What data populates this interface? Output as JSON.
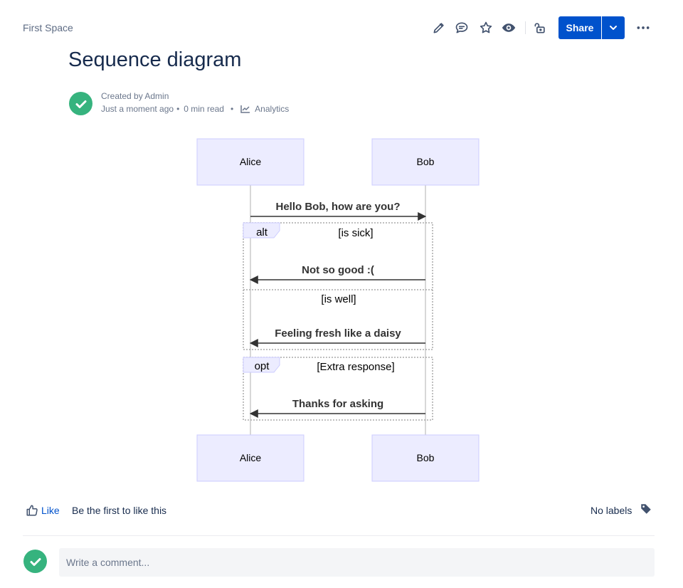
{
  "breadcrumb": "First Space",
  "header": {
    "share_label": "Share",
    "icons": [
      "edit-icon",
      "comment-icon",
      "star-icon",
      "watch-icon",
      "restrictions-icon",
      "share-dropdown-icon",
      "more-actions-icon"
    ]
  },
  "page": {
    "title": "Sequence diagram",
    "byline": {
      "created_by": "Created by Admin",
      "time": "Just a moment ago",
      "read_time": "0 min read",
      "analytics": "Analytics"
    }
  },
  "diagram": {
    "participants": [
      "Alice",
      "Bob"
    ],
    "messages": {
      "m1": "Hello Bob, how are you?",
      "m2": "Not so good :(",
      "m3": "Feeling fresh like a daisy",
      "m4": "Thanks for asking"
    },
    "fragments": {
      "alt_label": "alt",
      "alt_cond1": "[is sick]",
      "alt_cond2": "[is well]",
      "opt_label": "opt",
      "opt_cond": "[Extra response]"
    }
  },
  "footer": {
    "like_label": "Like",
    "like_hint": "Be the first to like this",
    "labels_text": "No labels",
    "comment_placeholder": "Write a comment..."
  },
  "colors": {
    "accent": "#0052cc",
    "success": "#36b37e",
    "actor_fill": "#ececff",
    "actor_stroke": "#ccccff",
    "line": "#333333"
  }
}
